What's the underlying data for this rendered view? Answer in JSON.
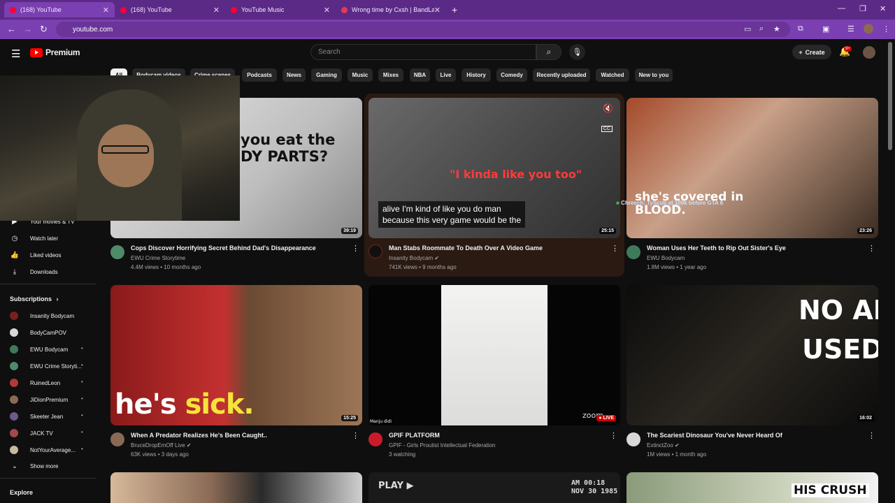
{
  "browser": {
    "tabs": [
      {
        "title": "(168) YouTube",
        "active": true
      },
      {
        "title": "(168) YouTube",
        "active": false
      },
      {
        "title": "YouTube Music",
        "active": false
      },
      {
        "title": "Wrong time by Cxsh | BandLab",
        "active": false
      }
    ],
    "url": "youtube.com",
    "accent": "#5b2a86"
  },
  "header": {
    "logo": "Premium",
    "search_placeholder": "Search",
    "create_label": "Create",
    "notif_count": "9+"
  },
  "chips": [
    "All",
    "Bodycam videos",
    "Crime scenes",
    "Podcasts",
    "News",
    "Gaming",
    "Music",
    "Mixes",
    "NBA",
    "Live",
    "History",
    "Comedy",
    "Recently uploaded",
    "Watched",
    "New to you"
  ],
  "sidebar": {
    "you_items": [
      {
        "label": "Your movies & TV",
        "icon": "clapper-icon"
      },
      {
        "label": "Watch later",
        "icon": "clock-icon"
      },
      {
        "label": "Liked videos",
        "icon": "thumbs-up-icon"
      },
      {
        "label": "Downloads",
        "icon": "download-icon"
      }
    ],
    "subs_heading": "Subscriptions",
    "subscriptions": [
      {
        "label": "Insanity Bodycam",
        "dot": false
      },
      {
        "label": "BodyCamPOV",
        "dot": false
      },
      {
        "label": "EWU Bodycam",
        "dot": true
      },
      {
        "label": "EWU Crime Storyti...",
        "dot": true
      },
      {
        "label": "RuinedLeon",
        "dot": true
      },
      {
        "label": "JiDionPremium",
        "dot": true
      },
      {
        "label": "Skeeter Jean",
        "dot": true
      },
      {
        "label": "JACK TV",
        "dot": true
      },
      {
        "label": "NotYourAverage...",
        "dot": true
      }
    ],
    "show_more": "Show more",
    "explore": "Explore"
  },
  "videos": [
    {
      "title": "Cops Discover Horrifying Secret Behind Dad's Disappearance",
      "channel": "EWU Crime Storytime",
      "verified": false,
      "views": "4.4M views",
      "age": "10 months ago",
      "duration": "39:19",
      "overlay": "you eat the\nDY PARTS?"
    },
    {
      "title": "Man Stabs Roommate To Death Over A Video Game",
      "channel": "Insanity Bodycam",
      "verified": true,
      "views": "741K views",
      "age": "9 months ago",
      "duration": "25:15",
      "overlay": "\"I kinda like you too\"",
      "captions": "alive I'm kind of like you do man\nbecause this very game would be the",
      "chat": "Chreech: TyScuti at 100k before GTA 6"
    },
    {
      "title": "Woman Uses Her Teeth to Rip Out Sister's Eye",
      "channel": "EWU Bodycam",
      "verified": false,
      "views": "1.8M views",
      "age": "1 year ago",
      "duration": "23:26",
      "overlay": "she's covered in\nBLOOD."
    },
    {
      "title": "When A Predator Realizes He's Been Caught..",
      "channel": "BruceDropEmOff Live",
      "verified": true,
      "views": "63K views",
      "age": "3 days ago",
      "duration": "15:25",
      "overlay_a": "he's ",
      "overlay_b": "sick."
    },
    {
      "title": "GPIF PLATFORM",
      "channel": "GPIF - Girls Proutist Intellectual Federation",
      "verified": false,
      "views": "3 watching",
      "age": "",
      "duration": "LIVE",
      "overlay": "Manju didi",
      "zoom": "zoom"
    },
    {
      "title": "The Scariest Dinosaur You've Never Heard Of",
      "channel": "ExtinctZoo",
      "verified": true,
      "views": "1M views",
      "age": "1 month ago",
      "duration": "16:02",
      "overlay": "NO AI\nUSED"
    }
  ],
  "row3_overlays": [
    "PLAY ▶",
    "AM 00:18\nNOV 30 1985",
    "HIS CRUSH"
  ]
}
